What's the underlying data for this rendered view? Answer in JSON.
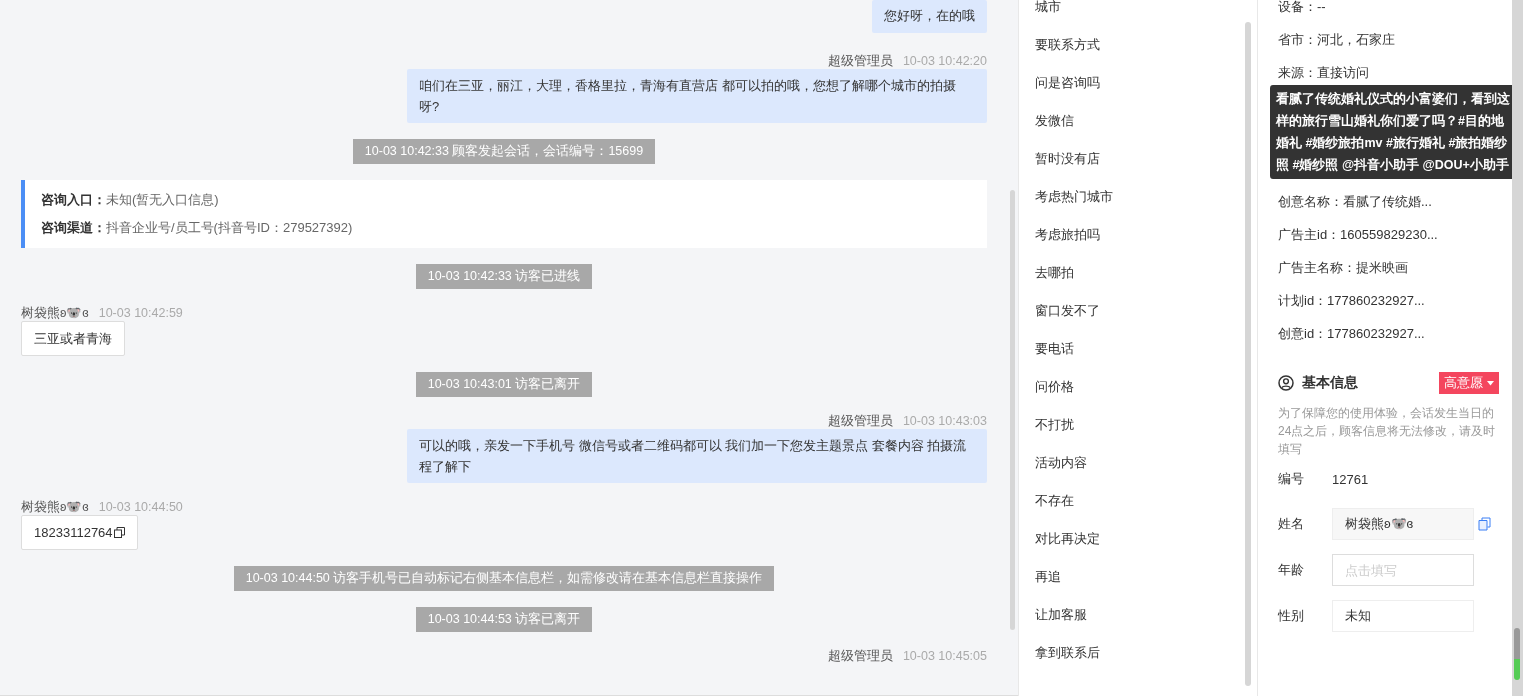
{
  "chat": [
    {
      "kind": "bubble",
      "text": "您好呀，在的哦"
    },
    {
      "kind": "agent",
      "sender": "超级管理员",
      "time": "10-03 10:42:20",
      "text": "咱们在三亚，丽江，大理，香格里拉，青海有直营店 都可以拍的哦，您想了解哪个城市的拍摄呀?"
    },
    {
      "kind": "system",
      "text": "10-03 10:42:33 顾客发起会话，会话编号：15699"
    },
    {
      "kind": "source",
      "rows": [
        {
          "label": "咨询入口：",
          "value": "未知(暂无入口信息)"
        },
        {
          "label": "咨询渠道：",
          "value": "抖音企业号/员工号(抖音号ID：279527392)"
        }
      ]
    },
    {
      "kind": "system",
      "text": "10-03 10:42:33 访客已进线"
    },
    {
      "kind": "visitor",
      "sender": "树袋熊ʚ🐨ɞ",
      "time": "10-03 10:42:59",
      "text": "三亚或者青海",
      "copy": false
    },
    {
      "kind": "system",
      "text": "10-03 10:43:01 访客已离开"
    },
    {
      "kind": "agent",
      "sender": "超级管理员",
      "time": "10-03 10:43:03",
      "text": "可以的哦，亲发一下手机号 微信号或者二维码都可以 我们加一下您发主题景点 套餐内容 拍摄流程了解下"
    },
    {
      "kind": "visitor",
      "sender": "树袋熊ʚ🐨ɞ",
      "time": "10-03 10:44:50",
      "text": "18233112764",
      "copy": true
    },
    {
      "kind": "system",
      "text": "10-03 10:44:50 访客手机号已自动标记右侧基本信息栏，如需修改请在基本信息栏直接操作"
    },
    {
      "kind": "system",
      "text": "10-03 10:44:53 访客已离开"
    },
    {
      "kind": "header",
      "sender": "超级管理员",
      "time": "10-03 10:45:05"
    }
  ],
  "quick_replies": [
    "城市",
    "要联系方式",
    "问是咨询吗",
    "发微信",
    "暂时没有店",
    "考虑热门城市",
    "考虑旅拍吗",
    "去哪拍",
    "窗口发不了",
    "要电话",
    "问价格",
    "不打扰",
    "活动内容",
    "不存在",
    "对比再决定",
    "再追",
    "让加客服",
    "拿到联系后"
  ],
  "visitor_info": {
    "rows_before": [
      "设备：--",
      "省市：河北，石家庄",
      "来源：直接访问"
    ],
    "tooltip": "看腻了传统婚礼仪式的小富婆们，看到这样的旅行雪山婚礼你们爱了吗？#目的地婚礼 #婚纱旅拍mv #旅行婚礼 #旅拍婚纱照 #婚纱照 @抖音小助手 @DOU+小助手",
    "rows_after": [
      "创意名称：看腻了传统婚...",
      "广告主id：160559829230...",
      "广告主名称：提米映画",
      "计划id：177860232927...",
      "创意id：177860232927..."
    ]
  },
  "basic_info": {
    "title": "基本信息",
    "intent": "高意愿",
    "notice": "为了保障您的使用体验，会话发生当日的24点之后，顾客信息将无法修改，请及时填写",
    "fields": [
      {
        "kind": "text",
        "label": "编号",
        "value": "12761"
      },
      {
        "kind": "copy",
        "label": "姓名",
        "value": "树袋熊ʚ🐨ɞ"
      },
      {
        "kind": "input",
        "label": "年龄",
        "placeholder": "点击填写"
      },
      {
        "kind": "select",
        "label": "性别",
        "value": "未知"
      }
    ]
  }
}
